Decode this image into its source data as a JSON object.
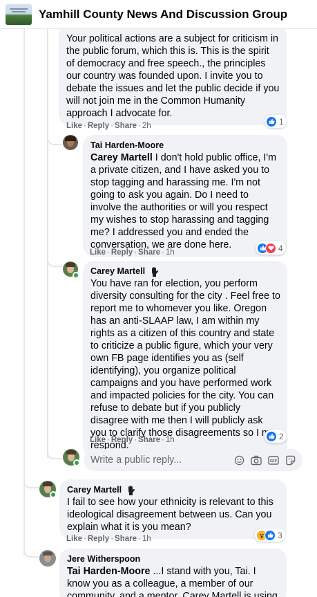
{
  "header": {
    "group_name": "Yamhill County News And Discussion Group"
  },
  "comments": [
    {
      "text": "Your political actions are a subject for criticism in the public forum, which this is. This is the spirit of democracy and free speech., the principles our country was founded upon. I invite you to debate the issues and let the public decide if you will not join me in the Common Humanity approach I advocate for.",
      "actions": {
        "like": "Like",
        "reply": "Reply",
        "share": "Share",
        "time": "2h"
      },
      "reactions": {
        "icons": [
          "like"
        ],
        "count": "1"
      }
    },
    {
      "author": "Tai Harden-Moore",
      "mention": "Carey Martell",
      "text": " I don't hold public office, I'm a private citizen, and I have asked you to stop tagging and harassing me. I'm not going to ask you again. Do I need to involve the authorities or will you respect my wishes to stop harassing and tagging me? I addressed you and ended the conversation, we are done here.",
      "actions": {
        "like": "Like",
        "reply": "Reply",
        "share": "Share",
        "time": "1h"
      },
      "reactions": {
        "icons": [
          "like",
          "love"
        ],
        "count": "4"
      }
    },
    {
      "author": "Carey Martell",
      "author_badge_icon": "raised-fist-icon",
      "text": "You have ran for election, you perform diversity consulting for the city . Feel free to report me to whomever you like. Oregon has an anti-SLAAP law, I am within my rights as a citizen of this country and state to criticize a public figure, which your very own FB page identifies you as (self identifying), you organize political campaigns and you have performed work and impacted policies for the city. You can refuse to debate but if you publicly disagree with me then I will publicly ask you to clarify those disagreements so I may respond.",
      "actions": {
        "like": "Like",
        "reply": "Reply",
        "share": "Share",
        "time": "1h"
      },
      "reactions": {
        "icons": [
          "like"
        ],
        "count": "2"
      }
    },
    {
      "author": "Carey Martell",
      "author_badge_icon": "raised-fist-icon",
      "text": "I fail to see how your ethnicity is relevant to this ideological disagreement between us. Can you explain what it is you mean?",
      "actions": {
        "like": "Like",
        "reply": "Reply",
        "share": "Share",
        "time": "1h"
      },
      "reactions": {
        "icons": [
          "wow",
          "like"
        ],
        "count": "3"
      }
    },
    {
      "author": "Jere Witherspoon",
      "mention": "Tai Harden-Moore",
      "text": " ...I stand with you, Tai. I know you as a colleague, a member of our community, and a mentor. Carey Martell is using this"
    }
  ],
  "reply_box": {
    "placeholder": "Write a public reply...",
    "icons": [
      "emoji-icon",
      "camera-icon",
      "gif-icon",
      "sticker-icon"
    ]
  },
  "colors": {
    "like": "#1877f2",
    "love": "#f33e58",
    "wow": "#f7b125",
    "bubble": "#f0f2f5",
    "meta": "#65676b",
    "online": "#31a24c"
  }
}
